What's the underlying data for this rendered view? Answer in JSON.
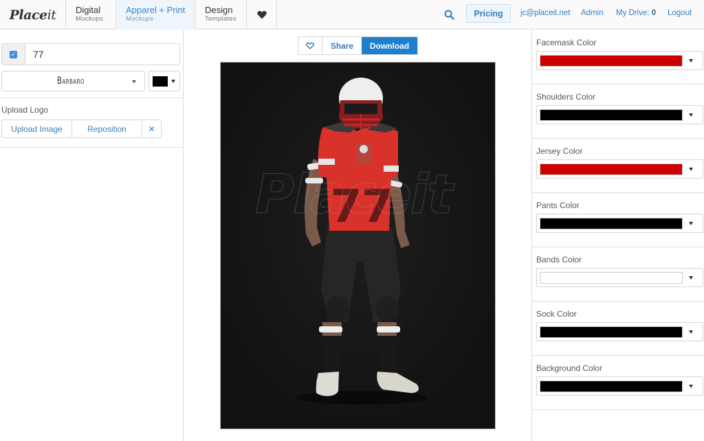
{
  "header": {
    "logo": {
      "bold": "Place",
      "light": "it"
    },
    "tabs": [
      {
        "title": "Digital",
        "subtitle": "Mockups",
        "active": false
      },
      {
        "title": "Apparel + Print",
        "subtitle": "Mockups",
        "active": true
      },
      {
        "title": "Design",
        "subtitle": "Templates",
        "active": false
      }
    ],
    "favorites_icon": "heart-icon",
    "search_icon": "search-icon",
    "pricing_label": "Pricing",
    "email": "jc@placeit.net",
    "admin_label": "Admin",
    "drive_label": "My Drive:",
    "drive_count": "0",
    "logout_label": "Logout"
  },
  "left_panel": {
    "number_enabled": true,
    "number_value": "77",
    "font_selected": "Barbaro",
    "text_color": "#000000",
    "upload_logo_label": "Upload Logo",
    "upload_image_label": "Upload Image",
    "reposition_label": "Reposition",
    "clear_label": "✕"
  },
  "center": {
    "favorite_icon": "heart-outline-icon",
    "share_label": "Share",
    "download_label": "Download",
    "watermark": "Placeit",
    "jersey_number": "77"
  },
  "right_panel": {
    "color_options": [
      {
        "label": "Facemask Color",
        "value": "#cc0000"
      },
      {
        "label": "Shoulders Color",
        "value": "#000000"
      },
      {
        "label": "Jersey Color",
        "value": "#cc0000"
      },
      {
        "label": "Pants Color",
        "value": "#000000"
      },
      {
        "label": "Bands Color",
        "value": "#ffffff"
      },
      {
        "label": "Sock Color",
        "value": "#000000"
      },
      {
        "label": "Background Color",
        "value": "#000000"
      }
    ]
  },
  "colors": {
    "accent": "#1e7fcf",
    "link": "#3a7cb8",
    "active_tab_bg": "#eef5fb"
  }
}
